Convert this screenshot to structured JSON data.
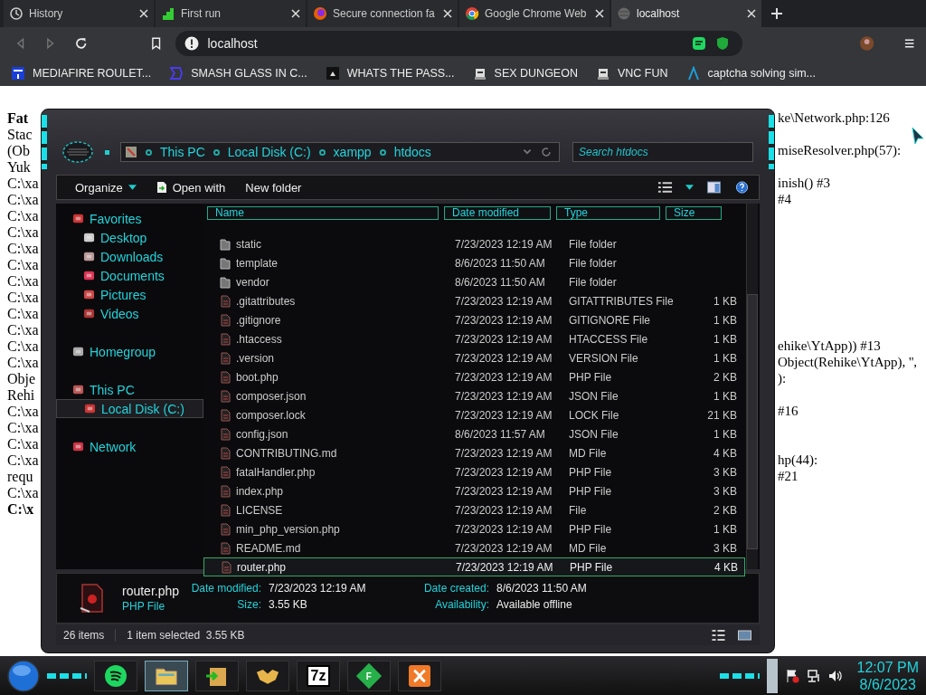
{
  "browser": {
    "tabs": [
      {
        "title": "History",
        "kind": "history",
        "selected": false
      },
      {
        "title": "First run",
        "kind": "steps",
        "selected": false
      },
      {
        "title": "Secure connection fa",
        "kind": "fox",
        "selected": false
      },
      {
        "title": "Google Chrome Web",
        "kind": "chrome",
        "selected": false
      },
      {
        "title": "localhost",
        "kind": "globe",
        "selected": true
      }
    ],
    "address": "localhost",
    "bookmarks": [
      {
        "label": "MEDIAFIRE ROULET...",
        "kind": "square"
      },
      {
        "label": "SMASH GLASS IN C...",
        "kind": "bracket"
      },
      {
        "label": "WHATS THE PASS...",
        "kind": "dark"
      },
      {
        "label": "SEX DUNGEON",
        "kind": "robot"
      },
      {
        "label": "VNC FUN",
        "kind": "robot"
      },
      {
        "label": "captcha solving sim...",
        "kind": "lambda"
      }
    ]
  },
  "page_behind": {
    "lines": [
      {
        "left": "Fat",
        "right": "ke\\Network.php:126",
        "bold": true
      },
      {
        "left": "Stac",
        "bold": false
      },
      {
        "left": "(Ob",
        "right": "miseResolver.php(57):",
        "bold": false
      },
      {
        "left": "Yuk",
        "bold": false
      },
      {
        "left": "C:\\xa",
        "right": "inish() #3",
        "bold": false
      },
      {
        "left": "C:\\xa",
        "right": "#4",
        "bold": false
      },
      {
        "left": "C:\\xa",
        "bold": false
      },
      {
        "left": "C:\\xa",
        "bold": false
      },
      {
        "left": "C:\\xa",
        "bold": false
      },
      {
        "left": "C:\\xa",
        "bold": false
      },
      {
        "left": "C:\\xa",
        "bold": false
      },
      {
        "left": "C:\\xa",
        "bold": false
      },
      {
        "left": "C:\\xa",
        "bold": false
      },
      {
        "left": "C:\\xa",
        "bold": false
      },
      {
        "left": "C:\\xa",
        "right": "ehike\\YtApp)) #13",
        "bold": false
      },
      {
        "left": "C:\\xa",
        "right": "Object(Rehike\\YtApp), '',",
        "bold": false
      },
      {
        "left": "Obje",
        "right": "):",
        "bold": false
      },
      {
        "left": "Rehi",
        "bold": false
      },
      {
        "left": "C:\\xa",
        "right": "#16",
        "bold": false
      },
      {
        "left": "C:\\xa",
        "bold": false
      },
      {
        "left": "C:\\xa",
        "bold": false
      },
      {
        "left": "C:\\xa",
        "right": "hp(44):",
        "bold": false
      },
      {
        "left": "requ",
        "right": "#21",
        "bold": false
      },
      {
        "left": "C:\\xa",
        "bold": false
      },
      {
        "left": "C:\\x",
        "bold": true
      }
    ]
  },
  "explorer": {
    "breadcrumb": [
      "This PC",
      "Local Disk (C:)",
      "xampp",
      "htdocs"
    ],
    "search": {
      "placeholder": "Search htdocs"
    },
    "toolbar": [
      {
        "label": "Organize",
        "kind": "menu"
      },
      {
        "label": "Open with",
        "kind": "open"
      },
      {
        "label": "New folder",
        "kind": "plain"
      }
    ],
    "nav": [
      {
        "label": "Favorites",
        "kind": "star",
        "selected": false,
        "children": [
          {
            "label": "Desktop",
            "kind": "desk",
            "selected": false
          },
          {
            "label": "Downloads",
            "kind": "down",
            "selected": false
          },
          {
            "label": "Documents",
            "kind": "doc",
            "selected": false
          },
          {
            "label": "Pictures",
            "kind": "pic",
            "selected": false
          },
          {
            "label": "Videos",
            "kind": "vid",
            "selected": false
          }
        ]
      },
      {
        "label": "Homegroup",
        "kind": "home",
        "selected": false
      },
      {
        "label": "This PC",
        "kind": "pc",
        "selected": false,
        "children": [
          {
            "label": "Local Disk (C:)",
            "kind": "disk",
            "selected": true
          }
        ]
      },
      {
        "label": "Network",
        "kind": "net",
        "selected": false
      }
    ],
    "columns": [
      "Name",
      "Date modified",
      "Type",
      "Size"
    ],
    "files": [
      {
        "name": "static",
        "date": "7/23/2023 12:19 AM",
        "type": "File folder",
        "kind": "folder",
        "selected": false
      },
      {
        "name": "template",
        "date": "8/6/2023 11:50 AM",
        "type": "File folder",
        "kind": "folder",
        "selected": false
      },
      {
        "name": "vendor",
        "date": "8/6/2023 11:50 AM",
        "type": "File folder",
        "kind": "folder",
        "selected": false
      },
      {
        "name": ".gitattributes",
        "date": "7/23/2023 12:19 AM",
        "type": "GITATTRIBUTES File",
        "size": "1 KB",
        "kind": "file",
        "selected": false
      },
      {
        "name": ".gitignore",
        "date": "7/23/2023 12:19 AM",
        "type": "GITIGNORE File",
        "size": "1 KB",
        "kind": "file",
        "selected": false
      },
      {
        "name": ".htaccess",
        "date": "7/23/2023 12:19 AM",
        "type": "HTACCESS File",
        "size": "1 KB",
        "kind": "file",
        "selected": false
      },
      {
        "name": ".version",
        "date": "7/23/2023 12:19 AM",
        "type": "VERSION File",
        "size": "1 KB",
        "kind": "file",
        "selected": false
      },
      {
        "name": "boot.php",
        "date": "7/23/2023 12:19 AM",
        "type": "PHP File",
        "size": "2 KB",
        "kind": "file",
        "selected": false
      },
      {
        "name": "composer.json",
        "date": "7/23/2023 12:19 AM",
        "type": "JSON File",
        "size": "1 KB",
        "kind": "file",
        "selected": false
      },
      {
        "name": "composer.lock",
        "date": "7/23/2023 12:19 AM",
        "type": "LOCK File",
        "size": "21 KB",
        "kind": "file",
        "selected": false
      },
      {
        "name": "config.json",
        "date": "8/6/2023 11:57 AM",
        "type": "JSON File",
        "size": "1 KB",
        "kind": "file",
        "selected": false
      },
      {
        "name": "CONTRIBUTING.md",
        "date": "7/23/2023 12:19 AM",
        "type": "MD File",
        "size": "4 KB",
        "kind": "file",
        "selected": false
      },
      {
        "name": "fatalHandler.php",
        "date": "7/23/2023 12:19 AM",
        "type": "PHP File",
        "size": "3 KB",
        "kind": "file",
        "selected": false
      },
      {
        "name": "index.php",
        "date": "7/23/2023 12:19 AM",
        "type": "PHP File",
        "size": "3 KB",
        "kind": "file",
        "selected": false
      },
      {
        "name": "LICENSE",
        "date": "7/23/2023 12:19 AM",
        "type": "File",
        "size": "2 KB",
        "kind": "file",
        "selected": false
      },
      {
        "name": "min_php_version.php",
        "date": "7/23/2023 12:19 AM",
        "type": "PHP File",
        "size": "1 KB",
        "kind": "file",
        "selected": false
      },
      {
        "name": "README.md",
        "date": "7/23/2023 12:19 AM",
        "type": "MD File",
        "size": "3 KB",
        "kind": "file",
        "selected": false
      },
      {
        "name": "router.php",
        "date": "7/23/2023 12:19 AM",
        "type": "PHP File",
        "size": "4 KB",
        "kind": "file",
        "selected": true
      }
    ],
    "details": {
      "name": "router.php",
      "type": "PHP File",
      "fields": [
        {
          "label": "Date modified:",
          "value": "7/23/2023 12:19 AM"
        },
        {
          "label": "Date created:",
          "value": "8/6/2023 11:50 AM"
        },
        {
          "label": "Size:",
          "value": "3.55 KB"
        },
        {
          "label": "Availability:",
          "value": "Available offline"
        }
      ]
    },
    "status": {
      "count": "26 items",
      "selection": "1 item selected  3.55 KB"
    }
  },
  "taskbar": {
    "apps": [
      {
        "kind": "music",
        "active": false
      },
      {
        "kind": "folder",
        "active": true
      },
      {
        "kind": "box",
        "active": false
      },
      {
        "kind": "hands",
        "active": false
      },
      {
        "kind": "text",
        "label": "7z",
        "active": false
      },
      {
        "kind": "diamond",
        "label": "F",
        "active": false
      },
      {
        "kind": "xampp",
        "active": false
      }
    ],
    "time": "12:07 PM",
    "date": "8/6/2023"
  }
}
